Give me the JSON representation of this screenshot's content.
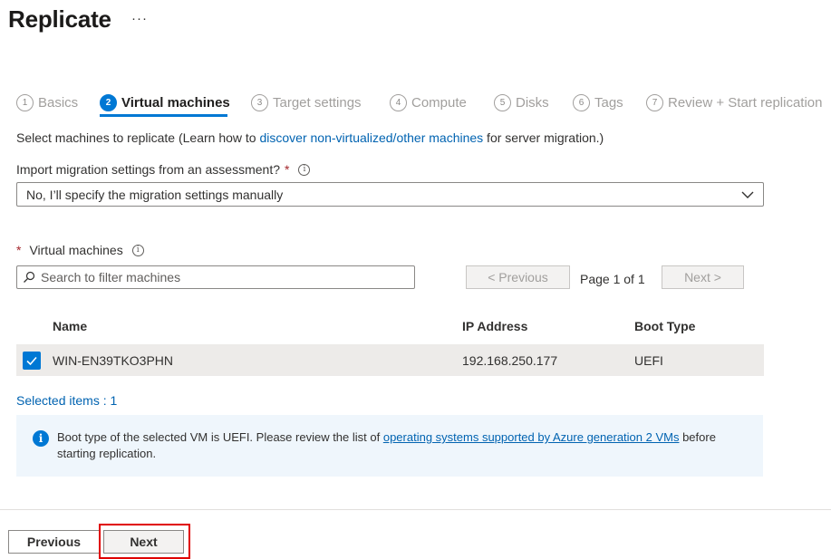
{
  "header": {
    "title": "Replicate",
    "more": "···"
  },
  "steps": [
    {
      "num": "1",
      "label": "Basics",
      "active": false
    },
    {
      "num": "2",
      "label": "Virtual machines",
      "active": true
    },
    {
      "num": "3",
      "label": "Target settings",
      "active": false
    },
    {
      "num": "4",
      "label": "Compute",
      "active": false
    },
    {
      "num": "5",
      "label": "Disks",
      "active": false
    },
    {
      "num": "6",
      "label": "Tags",
      "active": false
    },
    {
      "num": "7",
      "label": "Review + Start replication",
      "active": false
    }
  ],
  "intro": {
    "prefix": "Select machines to replicate (Learn how to ",
    "link": "discover non-virtualized/other machines",
    "suffix": " for server migration.)"
  },
  "import_question": {
    "label": "Import migration settings from an assessment?",
    "required_mark": "*",
    "info_glyph": "i",
    "selected_value": "No, I’ll specify the migration settings manually"
  },
  "vm_section": {
    "label": "Virtual machines",
    "required_mark": "*",
    "info_glyph": "i",
    "search_placeholder": "Search to filter machines",
    "previous_label": "< Previous",
    "page_info": "Page 1 of 1",
    "next_label": "Next >"
  },
  "table": {
    "columns": [
      "Name",
      "IP Address",
      "Boot Type"
    ],
    "rows": [
      {
        "name": "WIN-EN39TKO3PHN",
        "ip": "192.168.250.177",
        "boot": "UEFI",
        "checked": true
      }
    ]
  },
  "selected_items": "Selected items : 1",
  "info_banner": {
    "glyph": "i",
    "prefix": "Boot type of the selected VM is UEFI. Please review the list of ",
    "link": "operating systems supported by Azure generation 2 VMs",
    "suffix": " before starting replication."
  },
  "footer": {
    "previous_label": "Previous",
    "next_label": "Next"
  },
  "colors": {
    "accent": "#0078d4",
    "link": "#0063b1",
    "highlight": "#e00000",
    "row_selected": "#edebe9",
    "info_bg": "#eff6fc"
  },
  "icons": [
    "more-icon",
    "info-icon",
    "chevron-down-icon",
    "search-icon",
    "checkmark-icon"
  ]
}
